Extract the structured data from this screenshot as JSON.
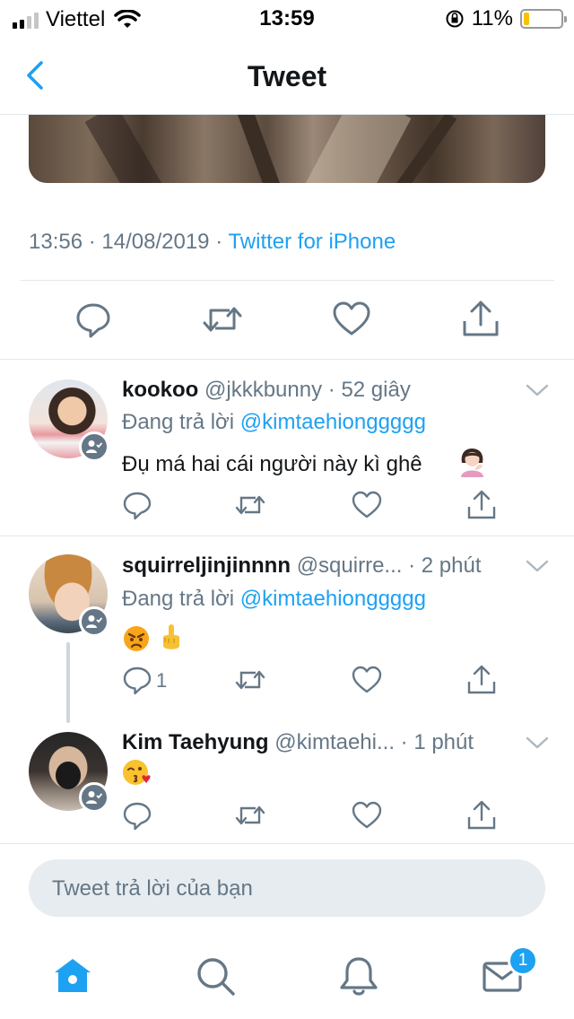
{
  "status_bar": {
    "carrier": "Viettel",
    "time": "13:59",
    "battery_percent": "11%",
    "battery_level": 0.11,
    "battery_color": "#f8c200",
    "icons": [
      "signal-icon",
      "wifi-icon",
      "orientation-lock-icon",
      "battery-icon"
    ]
  },
  "nav": {
    "title": "Tweet",
    "back_icon": "chevron-left-icon"
  },
  "tweet": {
    "time": "13:56",
    "separator": "·",
    "date": "14/08/2019",
    "source": "Twitter for iPhone",
    "actions": [
      "reply-icon",
      "retweet-icon",
      "like-icon",
      "share-icon"
    ]
  },
  "replies": [
    {
      "name": "kookoo",
      "handle": "@jkkkbunny",
      "age": "· 52 giây",
      "replying_label": "Đang trả lời",
      "replying_to": "@kimtaehionggggg",
      "text": "Đụ má hai cái người này kì ghê",
      "emoji": [
        "woman-tipping-hand-emoji"
      ],
      "reply_count": ""
    },
    {
      "name": "squirreljinjinnnn",
      "handle": "@squirre...",
      "age": "· 2 phút",
      "replying_label": "Đang trả lời",
      "replying_to": "@kimtaehionggggg",
      "text": "",
      "emoji": [
        "angry-face-emoji",
        "middle-finger-emoji"
      ],
      "reply_count": "1"
    },
    {
      "name": "Kim Taehyung",
      "handle": "@kimtaehi...",
      "age": "· 1 phút",
      "replying_label": "",
      "replying_to": "",
      "text": "",
      "emoji": [
        "face-blowing-kiss-emoji"
      ],
      "reply_count": ""
    }
  ],
  "compose": {
    "placeholder": "Tweet trả lời của bạn"
  },
  "tabbar": {
    "items": [
      "home-icon",
      "search-icon",
      "notifications-icon",
      "messages-icon"
    ],
    "messages_badge": "1"
  },
  "colors": {
    "accent": "#1da1f2",
    "secondary_text": "#657786",
    "divider": "#e1e8ed",
    "icon": "#657786"
  }
}
